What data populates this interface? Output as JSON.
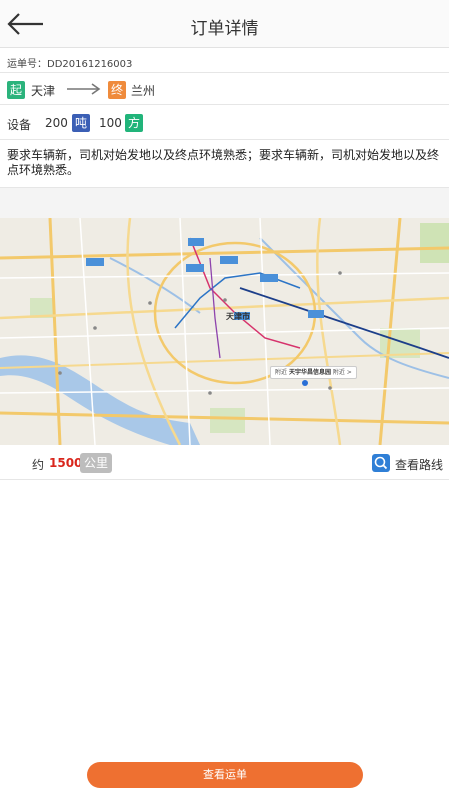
{
  "header": {
    "title": "订单详情",
    "back_icon": "arrow-left-icon"
  },
  "order": {
    "number_text": "运单号：DD20161216003"
  },
  "route": {
    "start_tag": "起",
    "start_city": "天津",
    "end_tag": "终",
    "end_city": "兰州",
    "start_color": "#2bb37c",
    "end_color": "#ef8b3c"
  },
  "device": {
    "label": "设备",
    "weight_value": "200",
    "weight_unit": "吨",
    "volume_value": "100",
    "volume_unit": "方",
    "weight_color": "#3b5fb5",
    "volume_color": "#21b47a"
  },
  "requirement": {
    "text": "要求车辆新，司机对始发地以及终点环境熟悉；要求车辆新，司机对始发地以及终点环境熟悉。"
  },
  "map": {
    "city_label": "天津市",
    "poi_label": "天宇华昌信息园",
    "poi_prefix": "附近",
    "poi_suffix": "附近 >"
  },
  "distance": {
    "prefix": "约",
    "value": "1500",
    "unit": "公里",
    "view_route_label": "查看路线"
  },
  "footer": {
    "button_label": "查看运单",
    "button_color": "#ee7031"
  }
}
